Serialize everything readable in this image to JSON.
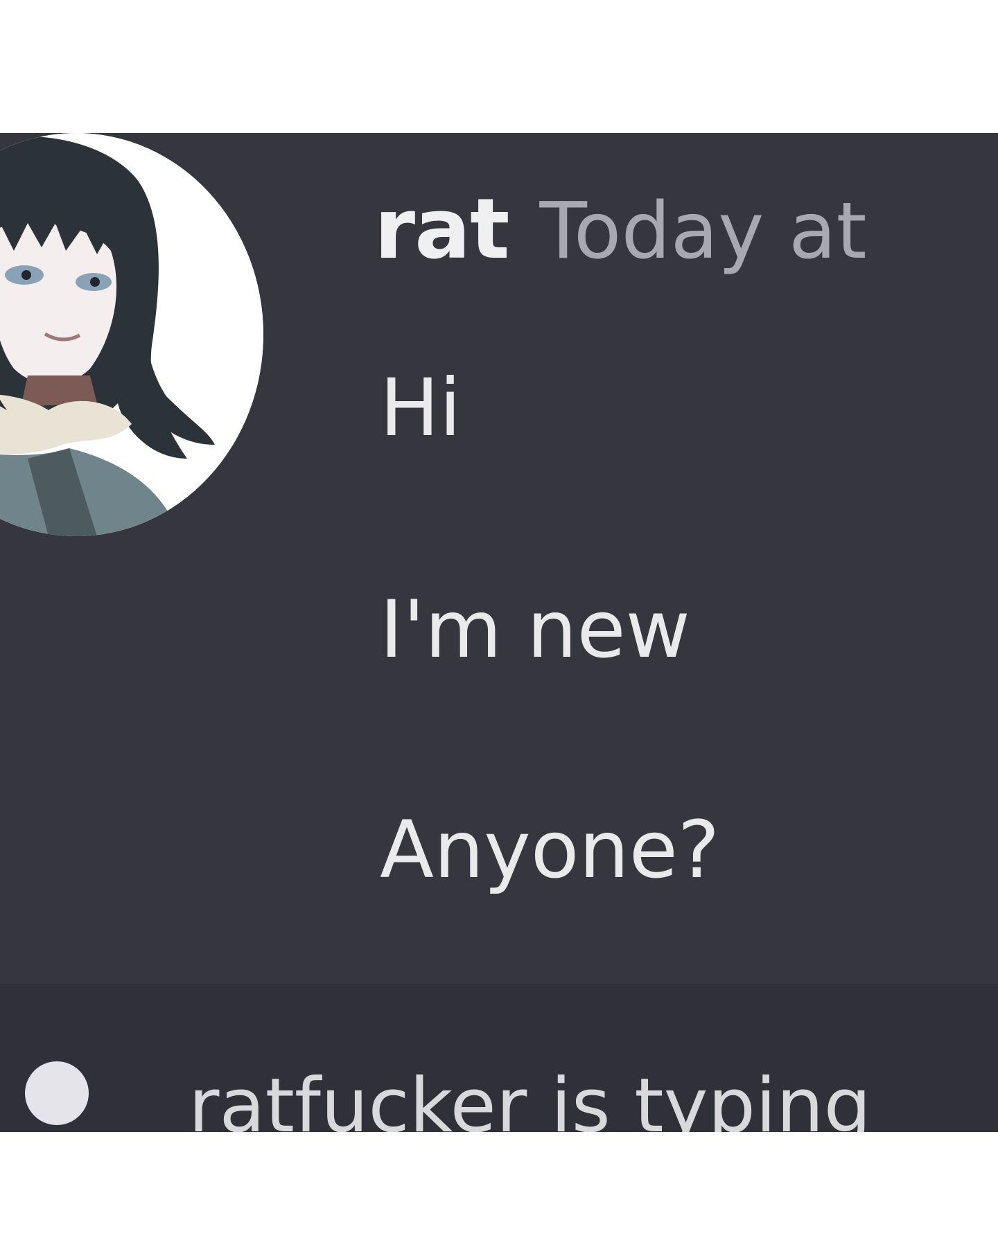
{
  "message": {
    "username": "rat",
    "timestamp": "Today at",
    "lines": [
      "Hi",
      "I'm new",
      "Anyone?"
    ]
  },
  "typing_indicator": {
    "text": "ratfucker is typing"
  },
  "avatar": {
    "icon": "user-avatar-anime-character"
  },
  "colors": {
    "chat_background": "#36363f",
    "username": "#f0f0f2",
    "timestamp": "#a8a9b0",
    "message_text": "#eaeaed"
  }
}
